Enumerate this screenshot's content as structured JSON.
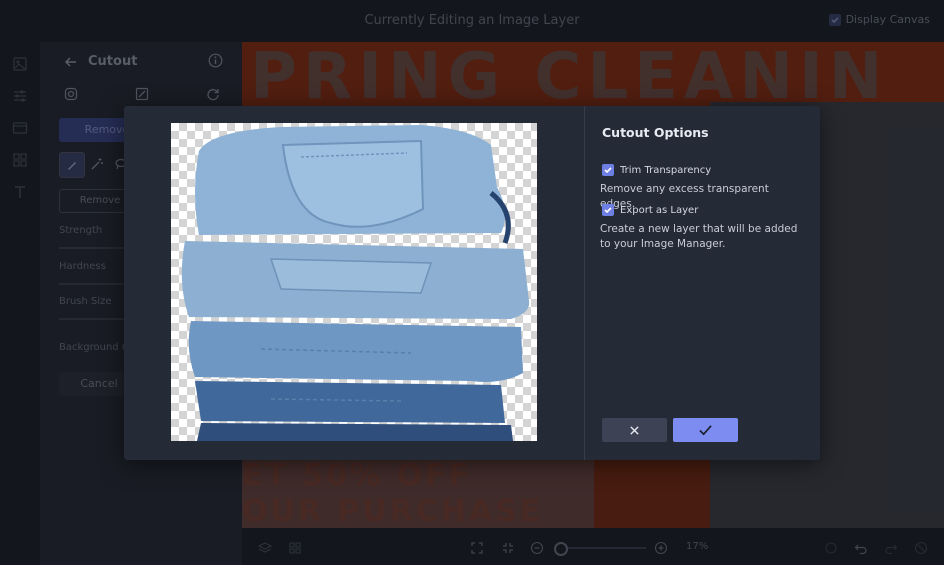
{
  "topbar": {
    "title": "Currently Editing an Image Layer",
    "display_canvas_label": "Display Canvas",
    "display_canvas_checked": true
  },
  "icon_rail": [
    "layers-icon",
    "sliders-icon",
    "frame-icon",
    "grid-icon",
    "text-icon"
  ],
  "panel": {
    "title": "Cutout",
    "remove_primary": "Remove",
    "remove_outline": "Remove",
    "strength_label": "Strength",
    "hardness_label": "Hardness",
    "brush_size_label": "Brush Size",
    "background_label": "Background Co",
    "cancel_label": "Cancel"
  },
  "canvas": {
    "headline": "PRING CLEANIN",
    "line1": "ET 50% OFF",
    "line2": "OUR PURCHASE"
  },
  "bottombar": {
    "zoom_level": "17%",
    "zoom_fraction": 0.0
  },
  "modal": {
    "title": "Cutout Options",
    "options": [
      {
        "label": "Trim Transparency",
        "checked": true,
        "description": "Remove any excess transparent edges."
      },
      {
        "label": "Export as Layer",
        "checked": true,
        "description": "Create a new layer that will be added to your Image Manager."
      }
    ]
  },
  "colors": {
    "accent": "#7c8cf0",
    "modal_bg": "#252a37",
    "app_bg": "#1f222b"
  }
}
